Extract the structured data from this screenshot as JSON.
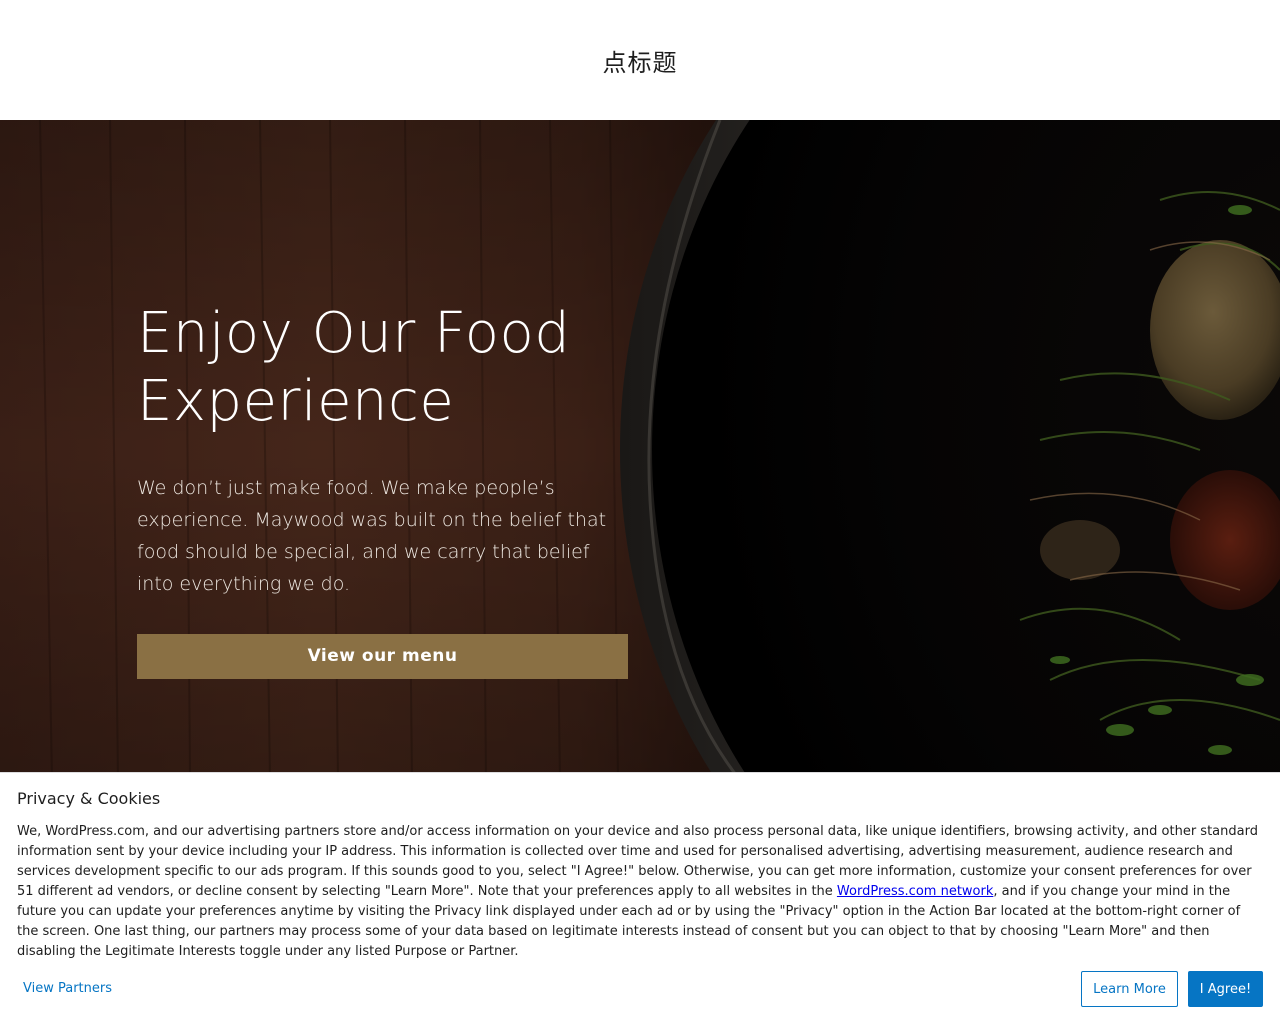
{
  "header": {
    "site_title": "点标题"
  },
  "hero": {
    "heading_line1": "Enjoy Our Food",
    "heading_line2": "Experience",
    "text": "We don’t just make food. We make people’s experience. Maywood was built on the belief that food should be special, and we carry that belief into everything we do.",
    "button_label": "View our menu",
    "colors": {
      "button": "#8a7044"
    }
  },
  "cookie_banner": {
    "title": "Privacy & Cookies",
    "body_before_link": "We, WordPress.com, and our advertising partners store and/or access information on your device and also process personal data, like unique identifiers, browsing activity, and other standard information sent by your device including your IP address. This information is collected over time and used for personalised advertising, advertising measurement, audience research and services development specific to our ads program. If this sounds good to you, select \"I Agree!\" below. Otherwise, you can get more information, customize your consent preferences for over 51 different ad vendors, or decline consent by selecting \"Learn More\". Note that your preferences apply to all websites in the ",
    "link_text": "WordPress.com network",
    "body_after_link": ", and if you change your mind in the future you can update your preferences anytime by visiting the Privacy link displayed under each ad or by using the \"Privacy\" option in the Action Bar located at the bottom-right corner of the screen. One last thing, our partners may process some of your data based on legitimate interests instead of consent but you can object to that by choosing \"Learn More\" and then disabling the Legitimate Interests toggle under any listed Purpose or Partner.",
    "view_partners_label": "View Partners",
    "learn_more_label": "Learn More",
    "agree_label": "I Agree!",
    "colors": {
      "accent": "#0675c4"
    }
  }
}
